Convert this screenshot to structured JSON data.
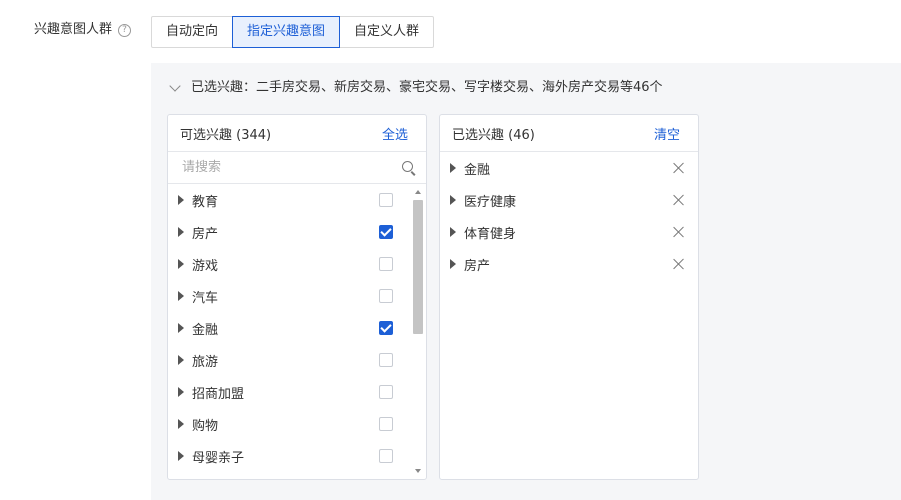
{
  "field": {
    "label": "兴趣意图人群",
    "help_icon": "?"
  },
  "targeting_tabs": [
    {
      "label": "自动定向",
      "active": false
    },
    {
      "label": "指定兴趣意图",
      "active": true
    },
    {
      "label": "自定义人群",
      "active": false
    }
  ],
  "summary": {
    "text": "已选兴趣：二手房交易、新房交易、豪宅交易、写字楼交易、海外房产交易等46个"
  },
  "available": {
    "title": "可选兴趣",
    "count": "(344)",
    "select_all_label": "全选",
    "search_placeholder": "请搜索",
    "items": [
      {
        "label": "教育",
        "checked": false
      },
      {
        "label": "房产",
        "checked": true
      },
      {
        "label": "游戏",
        "checked": false
      },
      {
        "label": "汽车",
        "checked": false
      },
      {
        "label": "金融",
        "checked": true
      },
      {
        "label": "旅游",
        "checked": false
      },
      {
        "label": "招商加盟",
        "checked": false
      },
      {
        "label": "购物",
        "checked": false
      },
      {
        "label": "母婴亲子",
        "checked": false
      }
    ]
  },
  "selected": {
    "title": "已选兴趣",
    "count": "(46)",
    "clear_label": "清空",
    "items": [
      {
        "label": "金融"
      },
      {
        "label": "医疗健康"
      },
      {
        "label": "体育健身"
      },
      {
        "label": "房产"
      }
    ]
  },
  "colors": {
    "accent": "#1d5fd6",
    "panel_bg": "#f5f6f8"
  }
}
